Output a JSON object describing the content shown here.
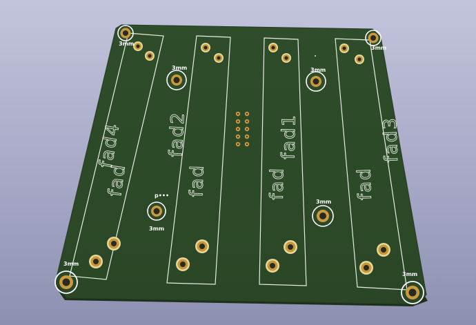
{
  "board": {
    "silkscreen_color": "#e8efe4",
    "board_color": "#2c4a28",
    "edge_color": "#1c2e1a",
    "pad_copper": "#c89a3a",
    "pad_ring": "#f3e6b0"
  },
  "module_labels": [
    {
      "id": "fad4",
      "name": "fad4",
      "sub": "fad"
    },
    {
      "id": "fad2",
      "name": "fad2",
      "sub": "fad"
    },
    {
      "id": "fad1",
      "name": "fad1",
      "sub": "fad"
    },
    {
      "id": "fad3",
      "name": "fad3",
      "sub": "fad"
    }
  ],
  "hole_labels": {
    "top_left": "3mm",
    "top_right": "3mm",
    "upper_mid_left": "3mm",
    "upper_mid_right": "3mm",
    "lower_mid_right": "3mm",
    "lower_mid_left": "3mm",
    "bottom_left": "3mm",
    "bottom_right": "3mm",
    "small_mark": "p•••"
  },
  "connector": {
    "rows": 5,
    "cols": 2
  }
}
